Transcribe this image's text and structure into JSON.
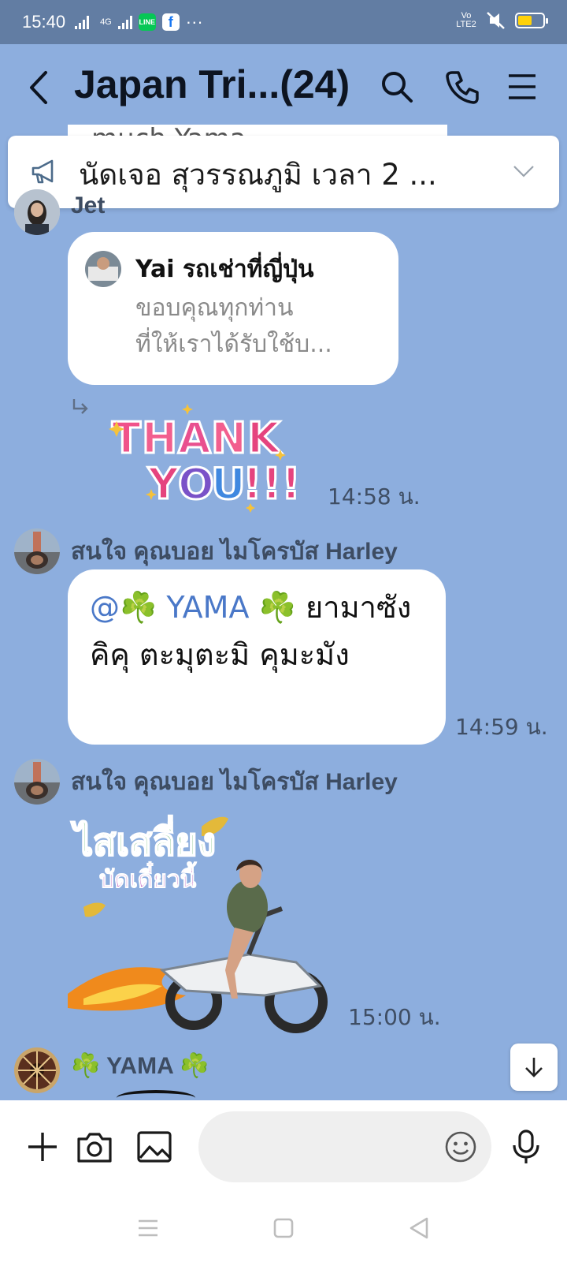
{
  "status_bar": {
    "time": "15:40",
    "network": "4G",
    "volte": "Vo LTE2"
  },
  "header": {
    "title": "Japan Tri...(24)",
    "back_icon": "chevron-left-icon",
    "search_icon": "search-icon",
    "call_icon": "phone-icon",
    "menu_icon": "hamburger-menu-icon"
  },
  "announcement": {
    "peek_text": "much  Yama",
    "text": "นัดเจอ สุวรรณภูมิ เวลา 2 ..."
  },
  "messages": [
    {
      "sender": "Jet",
      "reply": {
        "name": "Yai รถเช่าที่ญี่ปุ่น",
        "line1": "ขอบคุณทุกท่าน",
        "line2": "ที่ให้เราได้รับใช้บ..."
      },
      "sticker_text": "THANK YOU!!!",
      "time": "14:58 น."
    },
    {
      "sender": "สนใจ คุณบอย ไมโครบัส Harley",
      "mention": "@",
      "mention_name": "YAMA",
      "text_after": "ยามาซัง คิคุ ตะมุตะมิ คุมะมัง",
      "time": "14:59 น."
    },
    {
      "sender": "สนใจ คุณบอย ไมโครบัส Harley",
      "sticker_line1": "ไสเสลี่ยง",
      "sticker_line2": "บัดเดี๋ยวนี้",
      "time": "15:00 น."
    },
    {
      "sender": "YAMA"
    }
  ],
  "clover": "☘️",
  "input": {
    "placeholder": ""
  },
  "colors": {
    "background": "#8daede",
    "statusbar": "#627da3",
    "mention": "#4a78c8"
  }
}
